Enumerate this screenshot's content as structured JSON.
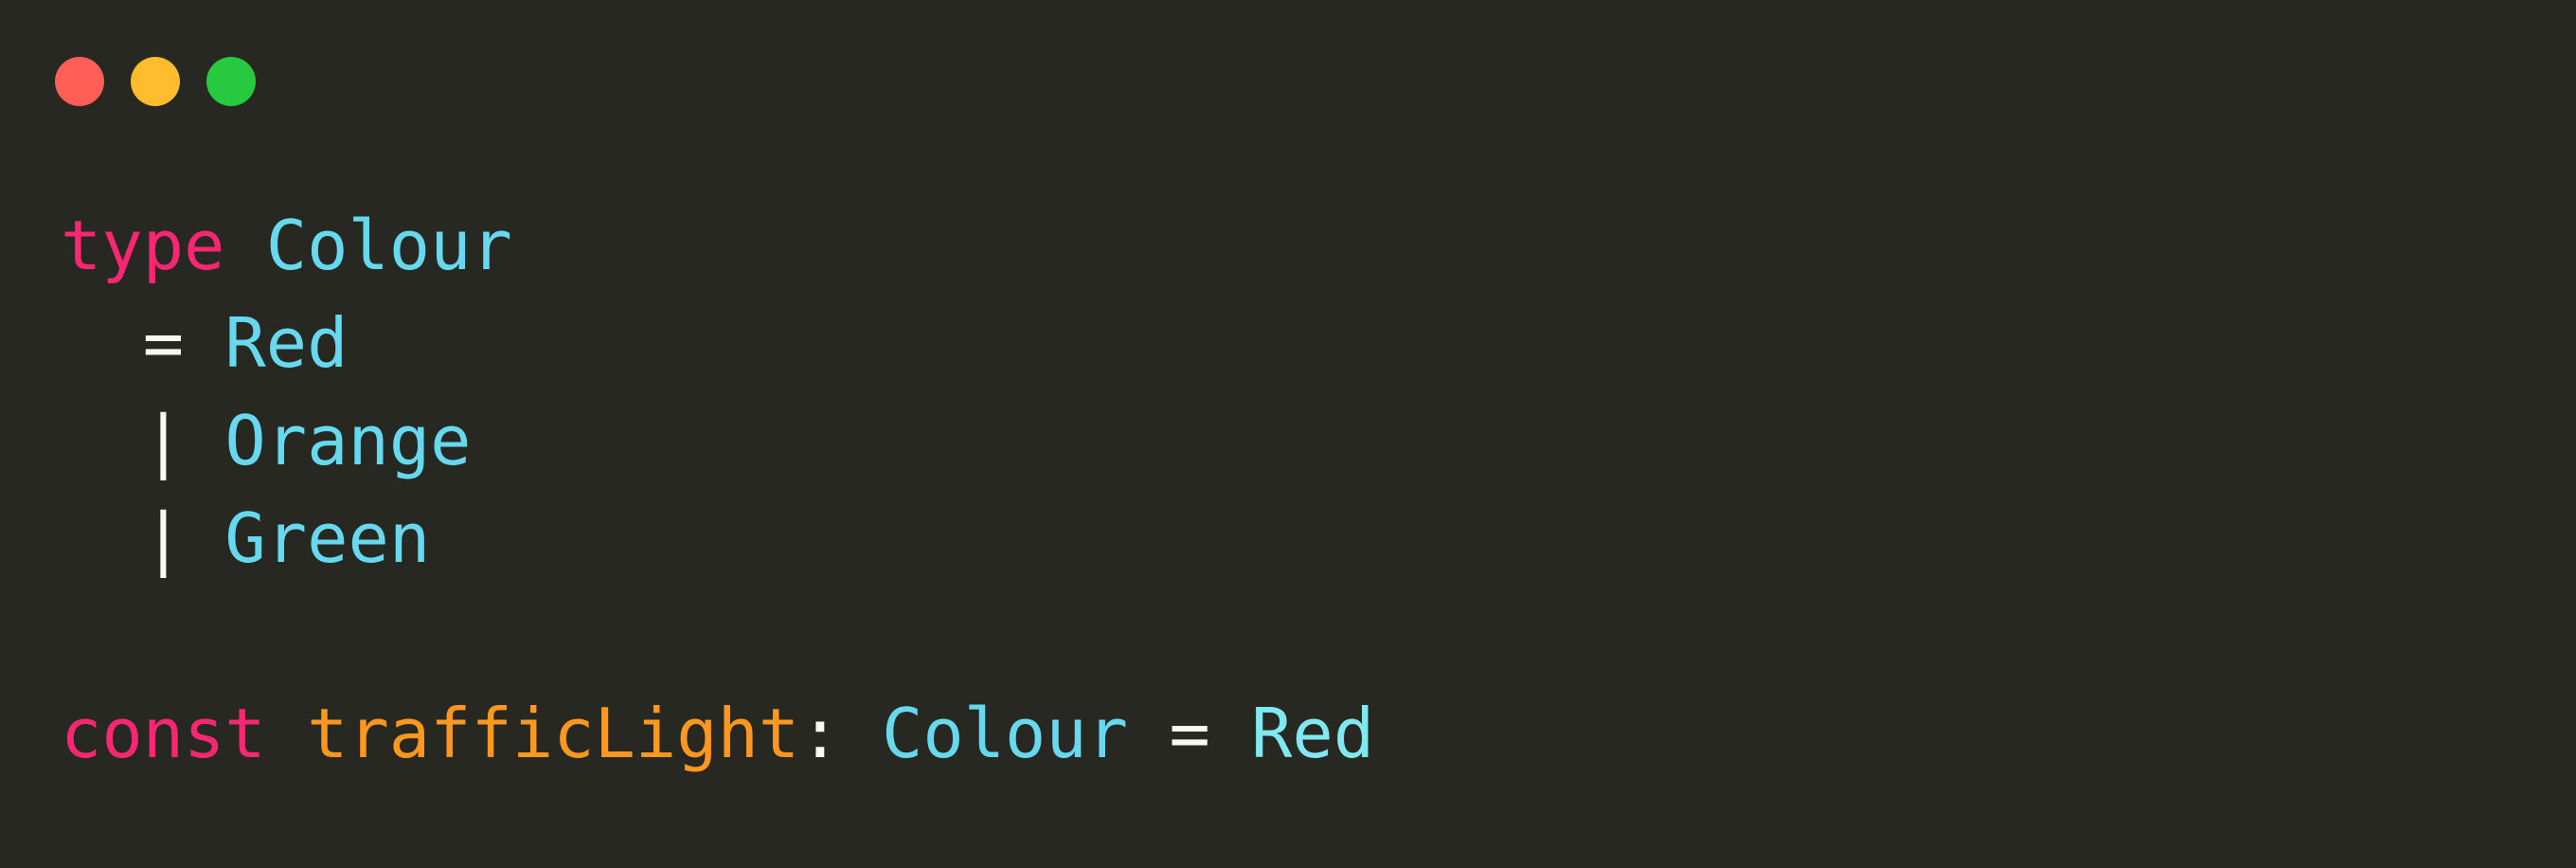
{
  "window_controls": {
    "close_color": "#ff5f56",
    "minimize_color": "#ffbd2e",
    "maximize_color": "#27c93f"
  },
  "theme": {
    "background": "#272822",
    "keyword": "#f92672",
    "type": "#66d9ef",
    "identifier": "#fd971f",
    "operator": "#f8f8f2"
  },
  "code": {
    "line1": {
      "keyword": "type",
      "name": "Colour"
    },
    "line2": {
      "op": "=",
      "variant": "Red"
    },
    "line3": {
      "op": "|",
      "variant": "Orange"
    },
    "line4": {
      "op": "|",
      "variant": "Green"
    },
    "line6": {
      "keyword": "const",
      "identifier": "trafficLight",
      "colon": ":",
      "type": "Colour",
      "op": "=",
      "value": "Red"
    }
  }
}
